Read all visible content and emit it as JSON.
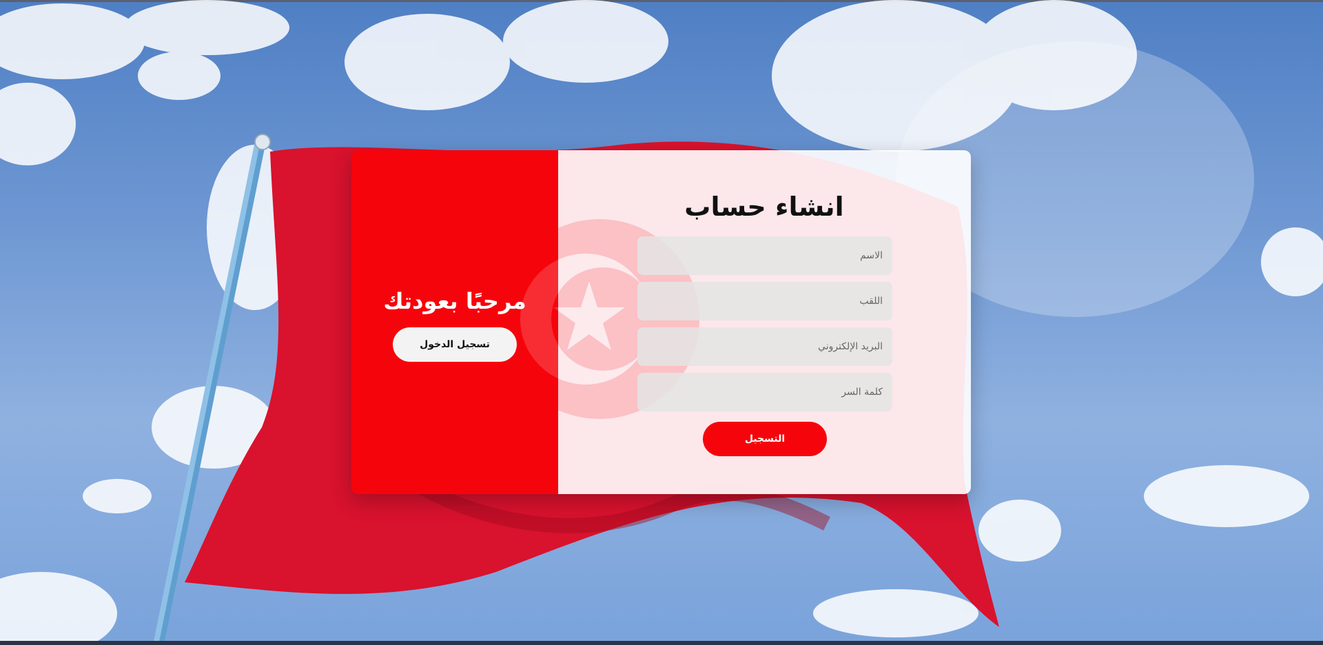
{
  "signin_panel": {
    "title": "مرحبًا بعودتك",
    "login_label": "تسجيل الدخول"
  },
  "signup_form": {
    "title": "انشاء حساب",
    "name_placeholder": "الاسم",
    "surname_placeholder": "اللقب",
    "email_placeholder": "البريد الإلكتروني",
    "password_placeholder": "كلمة السر",
    "register_label": "التسجيل"
  },
  "colors": {
    "accent": "#f6040c",
    "flag_red": "#d9122e",
    "sky": "#6f98d3"
  },
  "background": {
    "scene": "tunisian-flag-waving-against-blue-sky"
  }
}
